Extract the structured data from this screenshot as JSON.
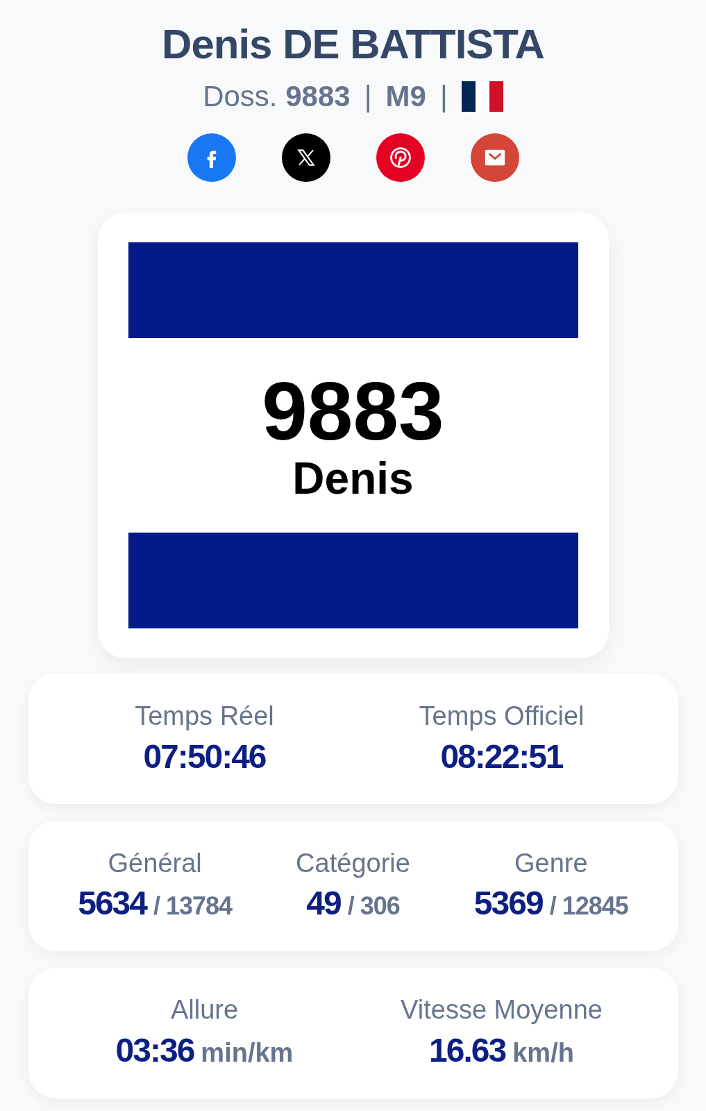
{
  "athlete": {
    "name": "Denis DE BATTISTA",
    "bib_label": "Doss.",
    "bib": "9883",
    "category": "M9",
    "separator": "|",
    "flag_stripes": [
      {
        "color": "#002654"
      },
      {
        "color": "#ffffff"
      },
      {
        "color": "#ce1126"
      }
    ]
  },
  "share": [
    {
      "kind": "facebook",
      "color": "#1877f2"
    },
    {
      "kind": "x",
      "color": "#000000"
    },
    {
      "kind": "pinterest",
      "color": "#e60023"
    },
    {
      "kind": "email",
      "color": "#d44638"
    }
  ],
  "bib_card": {
    "number": "9883",
    "name": "Denis"
  },
  "stat_cards": [
    {
      "items": [
        {
          "label": "Temps Réel",
          "value": "07:50:46"
        },
        {
          "label": "Temps Officiel",
          "value": "08:22:51"
        }
      ]
    },
    {
      "items": [
        {
          "label": "Général",
          "value": "5634",
          "total": "/ 13784"
        },
        {
          "label": "Catégorie",
          "value": "49",
          "total": "/ 306"
        },
        {
          "label": "Genre",
          "value": "5369",
          "total": "/ 12845"
        }
      ]
    },
    {
      "items": [
        {
          "label": "Allure",
          "value": "03:36",
          "unit": "min/km"
        },
        {
          "label": "Vitesse Moyenne",
          "value": "16.63",
          "unit": "km/h"
        }
      ]
    }
  ]
}
